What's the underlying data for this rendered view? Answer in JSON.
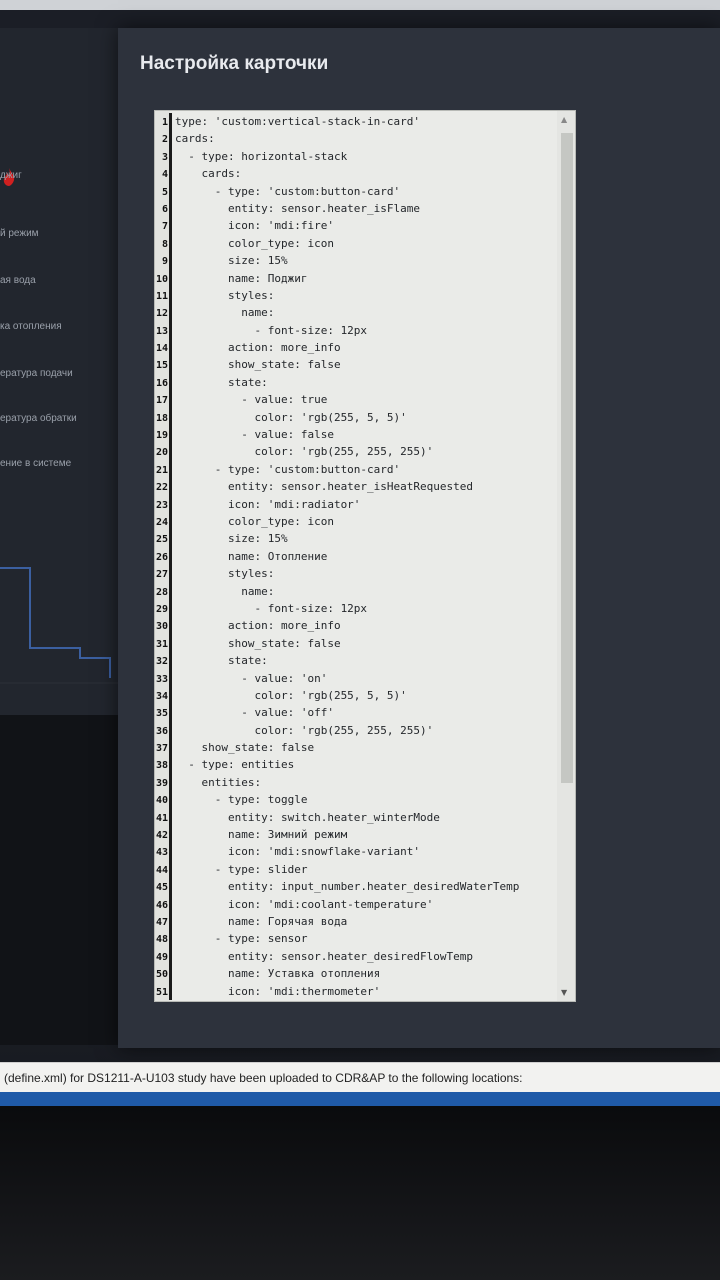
{
  "dialog": {
    "title": "Настройка карточки"
  },
  "left_panel": {
    "labels": [
      "джиг",
      "й режим",
      "ая вода",
      "ка отопления",
      "ература подачи",
      "ература обратки",
      "ение в системе"
    ]
  },
  "editor": {
    "lines": [
      {
        "n": "1",
        "text": "type: 'custom:vertical-stack-in-card'"
      },
      {
        "n": "2",
        "text": "cards:"
      },
      {
        "n": "3",
        "text": "  - type: horizontal-stack"
      },
      {
        "n": "4",
        "text": "    cards:"
      },
      {
        "n": "5",
        "text": "      - type: 'custom:button-card'"
      },
      {
        "n": "6",
        "text": "        entity: sensor.heater_isFlame"
      },
      {
        "n": "7",
        "text": "        icon: 'mdi:fire'"
      },
      {
        "n": "8",
        "text": "        color_type: icon"
      },
      {
        "n": "9",
        "text": "        size: 15%"
      },
      {
        "n": "10",
        "text": "        name: Поджиг"
      },
      {
        "n": "11",
        "text": "        styles:"
      },
      {
        "n": "12",
        "text": "          name:"
      },
      {
        "n": "13",
        "text": "            - font-size: 12px"
      },
      {
        "n": "14",
        "text": "        action: more_info"
      },
      {
        "n": "15",
        "text": "        show_state: false"
      },
      {
        "n": "16",
        "text": "        state:"
      },
      {
        "n": "17",
        "text": "          - value: true"
      },
      {
        "n": "18",
        "text": "            color: 'rgb(255, 5, 5)'"
      },
      {
        "n": "19",
        "text": "          - value: false"
      },
      {
        "n": "20",
        "text": "            color: 'rgb(255, 255, 255)'"
      },
      {
        "n": "21",
        "text": "      - type: 'custom:button-card'"
      },
      {
        "n": "22",
        "text": "        entity: sensor.heater_isHeatRequested"
      },
      {
        "n": "23",
        "text": "        icon: 'mdi:radiator'"
      },
      {
        "n": "24",
        "text": "        color_type: icon"
      },
      {
        "n": "25",
        "text": "        size: 15%"
      },
      {
        "n": "26",
        "text": "        name: Отопление"
      },
      {
        "n": "27",
        "text": "        styles:"
      },
      {
        "n": "28",
        "text": "          name:"
      },
      {
        "n": "29",
        "text": "            - font-size: 12px"
      },
      {
        "n": "30",
        "text": "        action: more_info"
      },
      {
        "n": "31",
        "text": "        show_state: false"
      },
      {
        "n": "32",
        "text": "        state:"
      },
      {
        "n": "33",
        "text": "          - value: 'on'"
      },
      {
        "n": "34",
        "text": "            color: 'rgb(255, 5, 5)'"
      },
      {
        "n": "35",
        "text": "          - value: 'off'"
      },
      {
        "n": "36",
        "text": "            color: 'rgb(255, 255, 255)'"
      },
      {
        "n": "37",
        "text": "    show_state: false"
      },
      {
        "n": "38",
        "text": "  - type: entities"
      },
      {
        "n": "39",
        "text": "    entities:"
      },
      {
        "n": "40",
        "text": "      - type: toggle"
      },
      {
        "n": "41",
        "text": "        entity: switch.heater_winterMode"
      },
      {
        "n": "42",
        "text": "        name: Зимний режим"
      },
      {
        "n": "43",
        "text": "        icon: 'mdi:snowflake-variant'"
      },
      {
        "n": "44",
        "text": "      - type: slider"
      },
      {
        "n": "45",
        "text": "        entity: input_number.heater_desiredWaterTemp"
      },
      {
        "n": "46",
        "text": "        icon: 'mdi:coolant-temperature'"
      },
      {
        "n": "47",
        "text": "        name: Горячая вода"
      },
      {
        "n": "48",
        "text": "      - type: sensor"
      },
      {
        "n": "49",
        "text": "        entity: sensor.heater_desiredFlowTemp"
      },
      {
        "n": "50",
        "text": "        name: Уставка отопления"
      },
      {
        "n": "51",
        "text": "        icon: 'mdi:thermometer'"
      }
    ]
  },
  "notification": {
    "text": "(define.xml)  for DS1211-A-U103 study have been uploaded to CDR&AP to the following locations:"
  },
  "colors": {
    "dialog_bg": "#2d323c",
    "editor_bg": "#eaebe8",
    "taskbar": "#1f5aa8",
    "flame": "#d02020"
  },
  "icons": {
    "left_flame": "fire-icon",
    "scroll_up": "arrow-up-icon",
    "scroll_down": "arrow-down-icon"
  }
}
